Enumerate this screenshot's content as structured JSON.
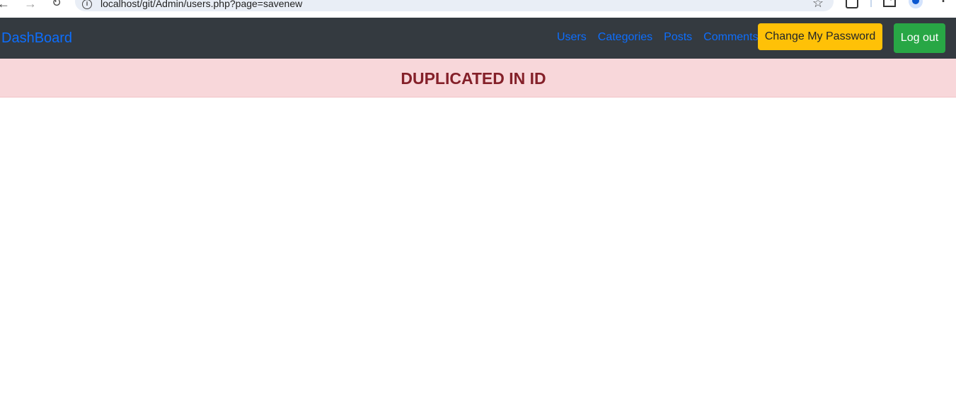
{
  "browser": {
    "url": "localhost/git/Admin/users.php?page=savenew",
    "icons": [
      "back-icon",
      "forward-icon",
      "reload-icon",
      "site-info-icon",
      "bookmark-star-icon",
      "extensions-icon",
      "download-icon",
      "profile-icon",
      "menu-icon"
    ]
  },
  "navbar": {
    "brand": "DashBoard",
    "links": [
      "Users",
      "Categories",
      "Posts",
      "Comments"
    ],
    "change_password_label": "Change My Password",
    "logout_label": "Log out"
  },
  "alert": {
    "message": "DUPLICATED IN ID"
  },
  "colors": {
    "navbar_bg": "#343a40",
    "link": "#0d6efd",
    "warning": "#ffc107",
    "success": "#28a745",
    "alert_bg": "#f8d7da",
    "alert_text": "#842029"
  }
}
